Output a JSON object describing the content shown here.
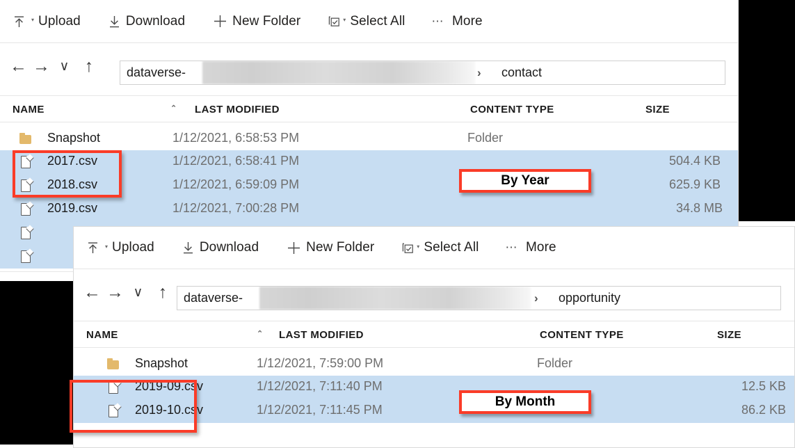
{
  "panels": [
    {
      "id": "contact",
      "toolbar": {
        "upload": "Upload",
        "download": "Download",
        "new_folder": "New Folder",
        "select_all": "Select All",
        "more": "More",
        "icons": [
          "upload-arrow-icon",
          "download-arrow-icon",
          "plus-icon",
          "checkbox-select-icon",
          "ellipsis-icon"
        ]
      },
      "nav": {
        "back": "←",
        "forward": "→",
        "history": "∨",
        "up": "↑"
      },
      "breadcrumb": {
        "account_prefix": "dataverse-",
        "separator": "›",
        "current": "contact"
      },
      "columns": {
        "name": "NAME",
        "last_modified": "LAST MODIFIED",
        "content_type": "CONTENT TYPE",
        "size": "SIZE",
        "sort_indicator": "⌃"
      },
      "rows": [
        {
          "name": "Snapshot",
          "icon": "folder-icon",
          "modified": "1/12/2021, 6:58:53 PM",
          "type": "Folder",
          "size": "",
          "selected": false
        },
        {
          "name": "2017.csv",
          "icon": "file-icon",
          "modified": "1/12/2021, 6:58:41 PM",
          "type": "",
          "size": "504.4 KB",
          "selected": true
        },
        {
          "name": "2018.csv",
          "icon": "file-icon",
          "modified": "1/12/2021, 6:59:09 PM",
          "type": "",
          "size": "625.9 KB",
          "selected": true
        },
        {
          "name": "2019.csv",
          "icon": "file-icon",
          "modified": "1/12/2021, 7:00:28 PM",
          "type": "",
          "size": "34.8 MB",
          "selected": true
        },
        {
          "name": "",
          "icon": "file-icon",
          "modified": "",
          "type": "",
          "size": "",
          "selected": true
        },
        {
          "name": "",
          "icon": "file-icon",
          "modified": "",
          "type": "",
          "size": "",
          "selected": true
        }
      ],
      "callout": "By Year"
    },
    {
      "id": "opportunity",
      "toolbar": {
        "upload": "Upload",
        "download": "Download",
        "new_folder": "New Folder",
        "select_all": "Select All",
        "more": "More",
        "icons": [
          "upload-arrow-icon",
          "download-arrow-icon",
          "plus-icon",
          "checkbox-select-icon",
          "ellipsis-icon"
        ]
      },
      "nav": {
        "back": "←",
        "forward": "→",
        "history": "∨",
        "up": "↑"
      },
      "breadcrumb": {
        "account_prefix": "dataverse-",
        "separator": "›",
        "current": "opportunity"
      },
      "columns": {
        "name": "NAME",
        "last_modified": "LAST MODIFIED",
        "content_type": "CONTENT TYPE",
        "size": "SIZE",
        "sort_indicator": "⌃"
      },
      "rows": [
        {
          "name": "Snapshot",
          "icon": "folder-icon",
          "modified": "1/12/2021, 7:59:00 PM",
          "type": "Folder",
          "size": "",
          "selected": false
        },
        {
          "name": "2019-09.csv",
          "icon": "file-icon",
          "modified": "1/12/2021, 7:11:40 PM",
          "type": "",
          "size": "12.5 KB",
          "selected": true
        },
        {
          "name": "2019-10.csv",
          "icon": "file-icon",
          "modified": "1/12/2021, 7:11:45 PM",
          "type": "",
          "size": "86.2 KB",
          "selected": true
        }
      ],
      "callout": "By Month"
    }
  ],
  "colors": {
    "annotation_red": "#fa3c28",
    "selection_blue": "#c7ddf2",
    "folder_gold": "#e3b96b",
    "text_primary": "#1b1b1b",
    "text_muted": "#6e6e6e"
  }
}
